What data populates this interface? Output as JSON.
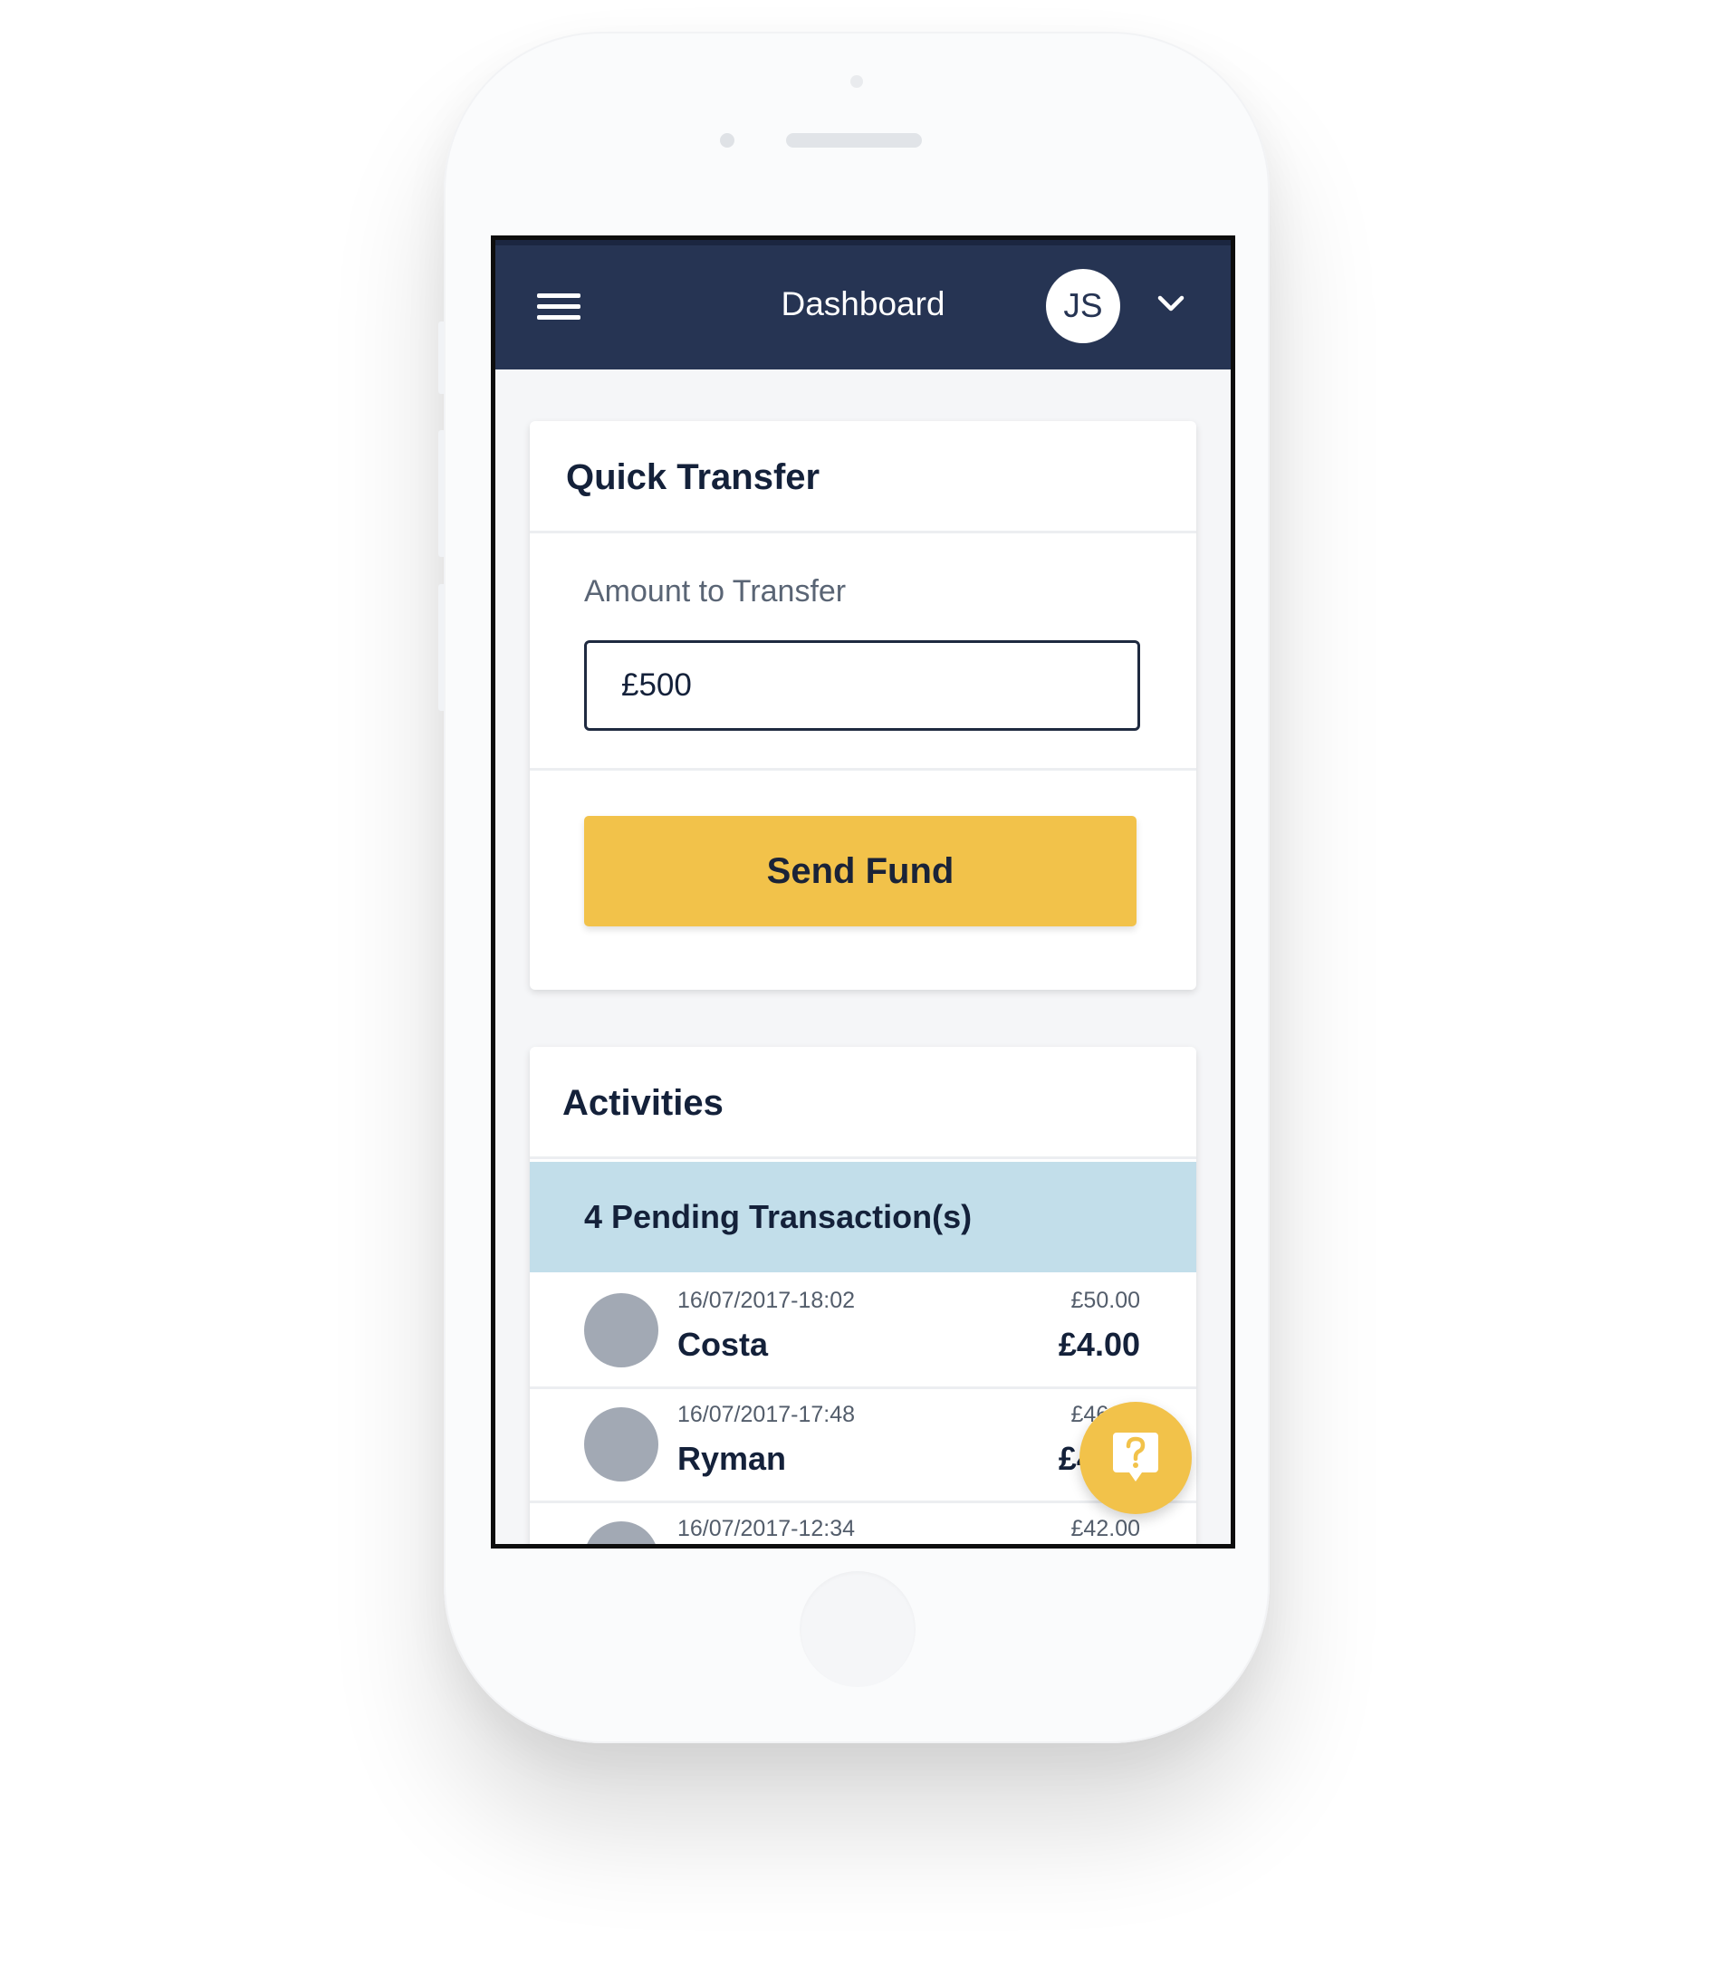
{
  "header": {
    "title": "Dashboard",
    "avatar_initials": "JS",
    "menu_icon": "hamburger-menu-icon",
    "dropdown_icon": "chevron-down-icon"
  },
  "quick_transfer": {
    "title": "Quick Transfer",
    "amount_label": "Amount to Transfer",
    "amount_value": "£500",
    "send_button_label": "Send Fund"
  },
  "activities": {
    "title": "Activities",
    "pending_label": "4 Pending Transaction(s)",
    "transactions": [
      {
        "date": "16/07/2017-18:02",
        "name": "Costa",
        "total": "£50.00",
        "amount": "£4.00"
      },
      {
        "date": "16/07/2017-17:48",
        "name": "Ryman",
        "total": "£46.00",
        "amount": "£4.00"
      },
      {
        "date": "16/07/2017-12:34",
        "name": "",
        "total": "£42.00",
        "amount": ""
      }
    ]
  },
  "help": {
    "icon": "help-question-icon"
  },
  "colors": {
    "navbar": "#263453",
    "accent": "#f2c24a",
    "pending_banner": "#c2deea",
    "text_dark": "#14213a",
    "avatar_placeholder": "#a2a9b4"
  }
}
